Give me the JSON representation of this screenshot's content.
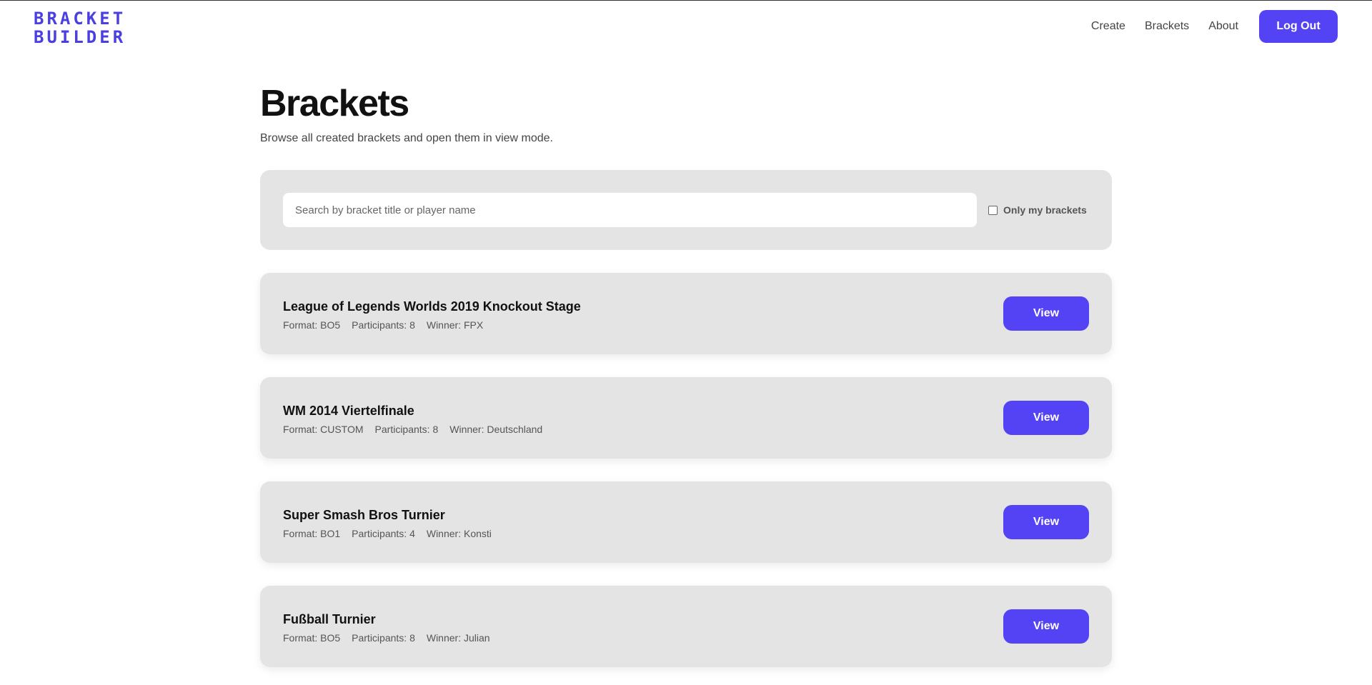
{
  "brand": {
    "line1": "BRACKET",
    "line2": "BUILDER",
    "color": "#4a3fe0"
  },
  "nav": {
    "create": "Create",
    "brackets": "Brackets",
    "about": "About",
    "logout": "Log Out"
  },
  "page": {
    "title": "Brackets",
    "subtitle": "Browse all created brackets and open them in view mode."
  },
  "filter": {
    "search_placeholder": "Search by bracket title or player name",
    "only_mine_label": "Only my brackets",
    "only_mine_checked": false
  },
  "brackets": [
    {
      "title": "League of Legends Worlds 2019 Knockout Stage",
      "format": "Format: BO5",
      "participants": "Participants: 8",
      "winner": "Winner: FPX",
      "action": "View"
    },
    {
      "title": "WM 2014 Viertelfinale",
      "format": "Format: CUSTOM",
      "participants": "Participants: 8",
      "winner": "Winner: Deutschland",
      "action": "View"
    },
    {
      "title": "Super Smash Bros Turnier",
      "format": "Format: BO1",
      "participants": "Participants: 4",
      "winner": "Winner: Konsti",
      "action": "View"
    },
    {
      "title": "Fußball Turnier",
      "format": "Format: BO5",
      "participants": "Participants: 8",
      "winner": "Winner: Julian",
      "action": "View"
    }
  ],
  "colors": {
    "accent": "#5343f5",
    "panel": "#e4e4e4"
  }
}
